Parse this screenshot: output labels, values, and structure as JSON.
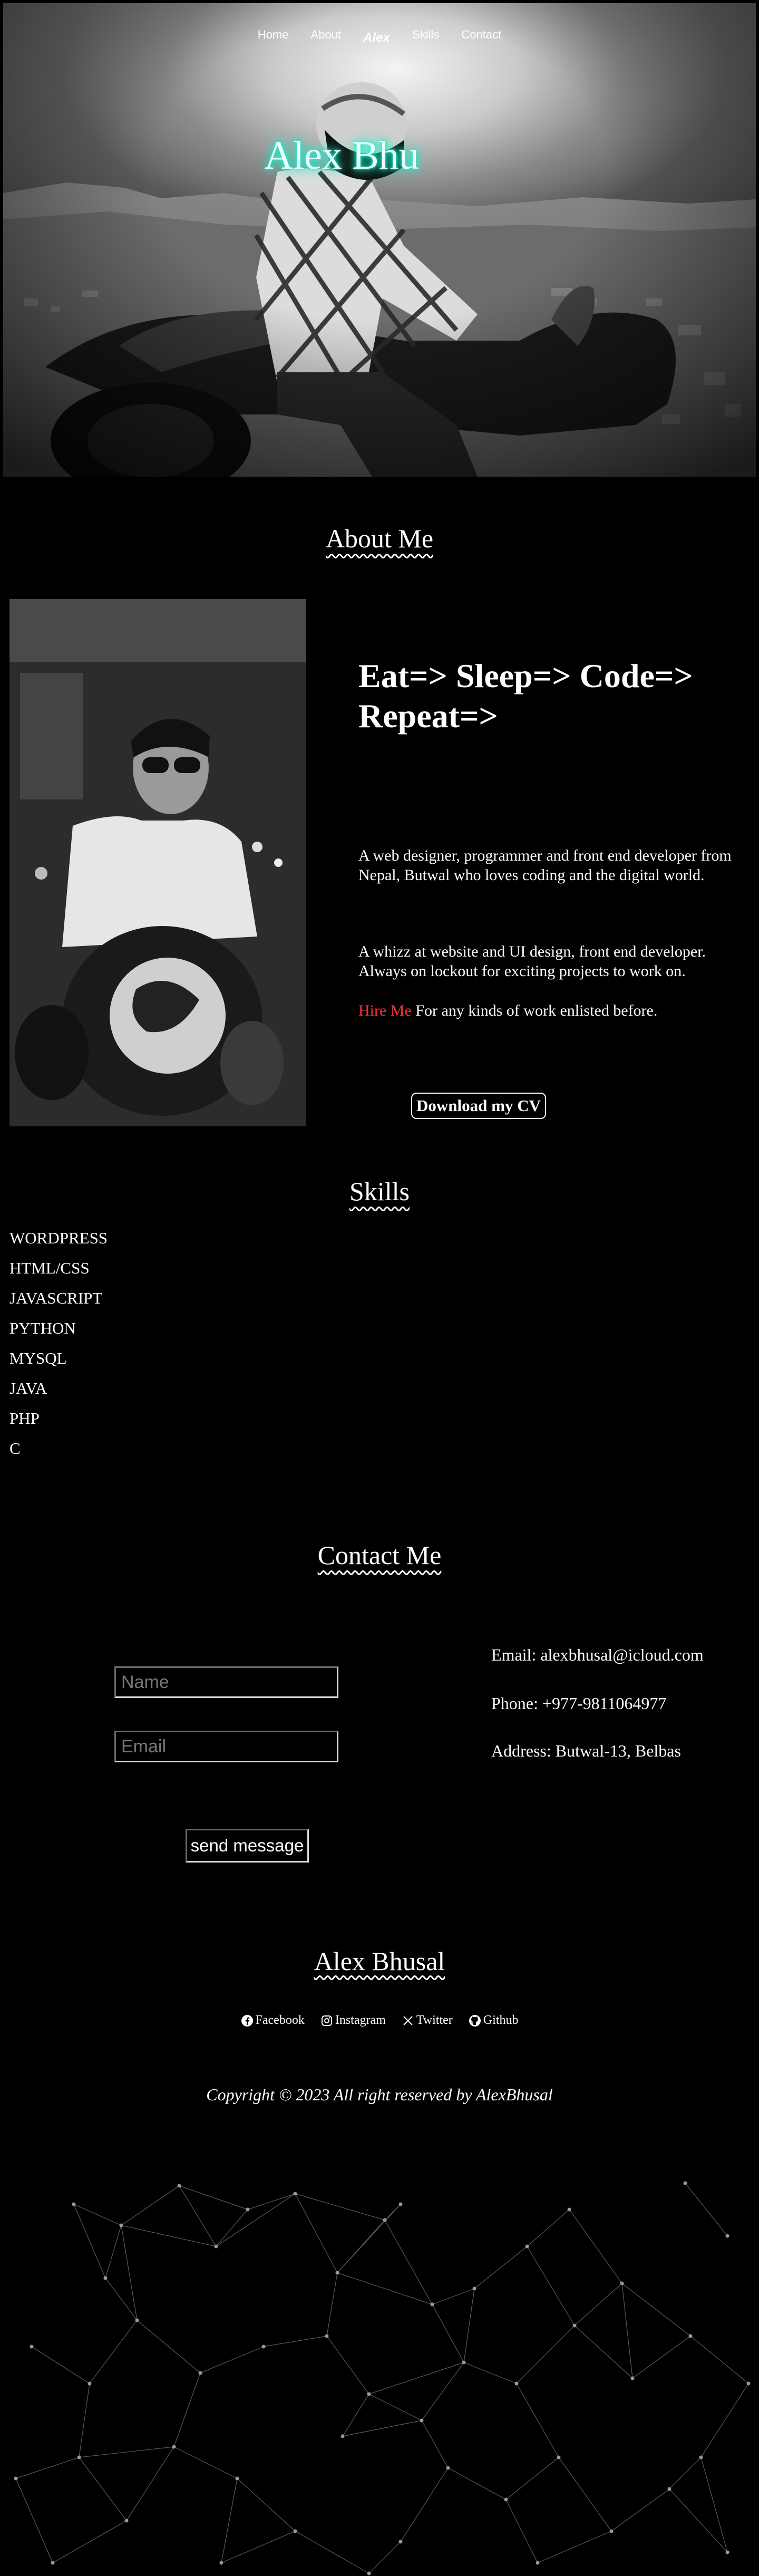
{
  "nav": {
    "items": [
      "Home",
      "About",
      "Alex",
      "Skills",
      "Contact"
    ]
  },
  "hero": {
    "title": "Alex Bhu"
  },
  "about": {
    "title": "About Me",
    "headline": "Eat=> Sleep=> Code=> Repeat=>",
    "para1": "A web designer, programmer and front end developer from Nepal, Butwal who loves coding and the digital world.",
    "para2": "A whizz at website and UI design, front end developer. Always on lockout for exciting projects to work on.",
    "hire_label": "Hire Me",
    "hire_text": " For any kinds of work enlisted before.",
    "cv_button": "Download my CV"
  },
  "skills": {
    "title": "Skills",
    "items": [
      "WORDPRESS",
      "HTML/CSS",
      "JAVASCRIPT",
      "PYTHON",
      "MYSQL",
      "JAVA",
      "PHP",
      "C"
    ]
  },
  "contact": {
    "title": "Contact Me",
    "name_placeholder": "Name",
    "email_placeholder": "Email",
    "send_button": "send message",
    "email": "Email: alexbhusal@icloud.com",
    "phone": "Phone: +977-9811064977",
    "address": "Address: Butwal-13, Belbas"
  },
  "footer": {
    "name": "Alex Bhusal",
    "social": [
      {
        "label": "Facebook",
        "icon": "facebook-icon"
      },
      {
        "label": "Instagram",
        "icon": "instagram-icon"
      },
      {
        "label": "Twitter",
        "icon": "x-twitter-icon"
      },
      {
        "label": "Github",
        "icon": "github-icon"
      }
    ],
    "copyright": "Copyright © 2023 All right reserved by AlexBhusal"
  },
  "colors": {
    "background": "#000000",
    "hero_glow": "#1de9d0",
    "hire_me": "#ff3030"
  }
}
